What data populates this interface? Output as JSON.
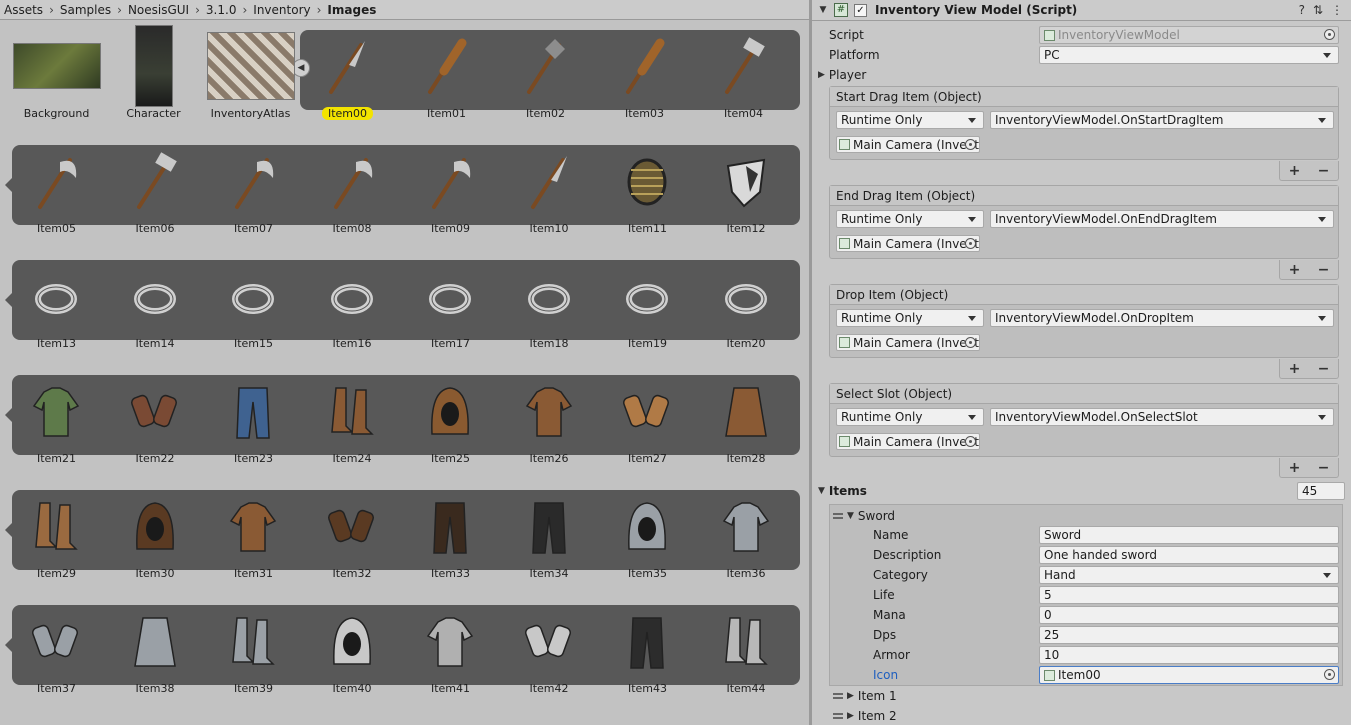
{
  "breadcrumb": [
    "Assets",
    "Samples",
    "NoesisGUI",
    "3.1.0",
    "Inventory",
    "Images"
  ],
  "assets": {
    "background_label": "Background",
    "character_label": "Character",
    "atlas_label": "InventoryAtlas",
    "selected_item": "Item00",
    "items": [
      "Item00",
      "Item01",
      "Item02",
      "Item03",
      "Item04",
      "Item05",
      "Item06",
      "Item07",
      "Item08",
      "Item09",
      "Item10",
      "Item11",
      "Item12",
      "Item13",
      "Item14",
      "Item15",
      "Item16",
      "Item17",
      "Item18",
      "Item19",
      "Item20",
      "Item21",
      "Item22",
      "Item23",
      "Item24",
      "Item25",
      "Item26",
      "Item27",
      "Item28",
      "Item29",
      "Item30",
      "Item31",
      "Item32",
      "Item33",
      "Item34",
      "Item35",
      "Item36",
      "Item37",
      "Item38",
      "Item39",
      "Item40",
      "Item41",
      "Item42",
      "Item43",
      "Item44"
    ],
    "item_icons": [
      "dagger",
      "club",
      "mace",
      "spiked-club",
      "hammer",
      "hand-axe",
      "war-hammer",
      "axe",
      "halberd",
      "battle-axe",
      "knife",
      "round-shield",
      "kite-shield",
      "ring",
      "ring",
      "ring",
      "ring",
      "ring",
      "ring",
      "ring",
      "ring",
      "shirt",
      "gloves",
      "pants",
      "sandals",
      "hood",
      "tunic",
      "bracers",
      "skirt",
      "boots",
      "helm",
      "vest",
      "gauntlets",
      "greaves",
      "leggings",
      "coif",
      "chainmail",
      "chain-gloves",
      "chain-skirt",
      "chain-boots",
      "helmet",
      "plate-armor",
      "plate-gloves",
      "plate-leggings",
      "plate-boots"
    ]
  },
  "inspector": {
    "component_title": "Inventory View Model (Script)",
    "script_label": "Script",
    "script_value": "InventoryViewModel",
    "platform_label": "Platform",
    "platform_value": "PC",
    "player_label": "Player",
    "events": [
      {
        "title": "Start Drag Item (Object)",
        "mode": "Runtime Only",
        "function": "InventoryViewModel.OnStartDragItem",
        "target": "Main Camera (Invent"
      },
      {
        "title": "End Drag Item (Object)",
        "mode": "Runtime Only",
        "function": "InventoryViewModel.OnEndDragItem",
        "target": "Main Camera (Invent"
      },
      {
        "title": "Drop Item (Object)",
        "mode": "Runtime Only",
        "function": "InventoryViewModel.OnDropItem",
        "target": "Main Camera (Invent"
      },
      {
        "title": "Select Slot (Object)",
        "mode": "Runtime Only",
        "function": "InventoryViewModel.OnSelectSlot",
        "target": "Main Camera (Invent"
      }
    ],
    "items_label": "Items",
    "items_count": "45",
    "sword": {
      "header": "Sword",
      "fields": [
        {
          "label": "Name",
          "value": "Sword"
        },
        {
          "label": "Description",
          "value": "One handed sword"
        },
        {
          "label": "Category",
          "value": "Hand"
        },
        {
          "label": "Life",
          "value": "5"
        },
        {
          "label": "Mana",
          "value": "0"
        },
        {
          "label": "Dps",
          "value": "25"
        },
        {
          "label": "Armor",
          "value": "10"
        },
        {
          "label": "Icon",
          "value": "Item00"
        }
      ]
    },
    "more_items": [
      "Item 1",
      "Item 2"
    ],
    "add_symbol": "+",
    "remove_symbol": "−"
  },
  "colors": {
    "accent_selected": "#f3e300",
    "icon_link": "#1f5fbf",
    "strip": "#585858"
  }
}
